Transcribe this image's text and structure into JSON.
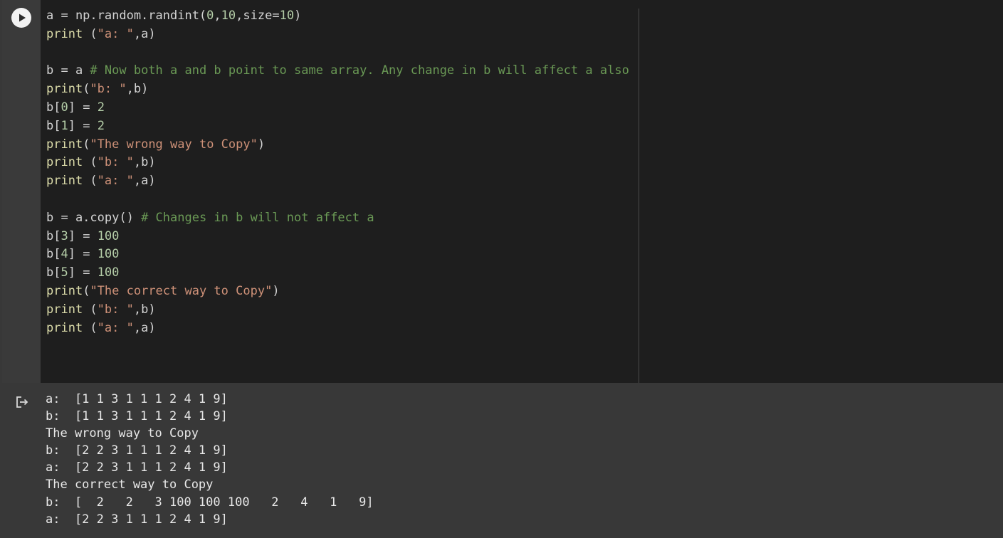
{
  "code_cell": {
    "run_button_icon": "play-icon",
    "lines": [
      [
        [
          "default",
          "a = np.random.randint("
        ],
        [
          "num",
          "0"
        ],
        [
          "default",
          ","
        ],
        [
          "num",
          "10"
        ],
        [
          "default",
          ",size="
        ],
        [
          "num",
          "10"
        ],
        [
          "default",
          ")"
        ]
      ],
      [
        [
          "fn",
          "print"
        ],
        [
          "default",
          " ("
        ],
        [
          "str",
          "\"a: \""
        ],
        [
          "default",
          ",a)"
        ]
      ],
      [],
      [
        [
          "default",
          "b = a "
        ],
        [
          "cmt",
          "# Now both a and b point to same array. Any change in b will affect a also"
        ]
      ],
      [
        [
          "fn",
          "print"
        ],
        [
          "default",
          "("
        ],
        [
          "str",
          "\"b: \""
        ],
        [
          "default",
          ",b)"
        ]
      ],
      [
        [
          "default",
          "b["
        ],
        [
          "num",
          "0"
        ],
        [
          "default",
          "] = "
        ],
        [
          "num",
          "2"
        ]
      ],
      [
        [
          "default",
          "b["
        ],
        [
          "num",
          "1"
        ],
        [
          "default",
          "] = "
        ],
        [
          "num",
          "2"
        ]
      ],
      [
        [
          "fn",
          "print"
        ],
        [
          "default",
          "("
        ],
        [
          "str",
          "\"The wrong way to Copy\""
        ],
        [
          "default",
          ")"
        ]
      ],
      [
        [
          "fn",
          "print"
        ],
        [
          "default",
          " ("
        ],
        [
          "str",
          "\"b: \""
        ],
        [
          "default",
          ",b)"
        ]
      ],
      [
        [
          "fn",
          "print"
        ],
        [
          "default",
          " ("
        ],
        [
          "str",
          "\"a: \""
        ],
        [
          "default",
          ",a)"
        ]
      ],
      [],
      [
        [
          "default",
          "b = a.copy() "
        ],
        [
          "cmt",
          "# Changes in b will not affect a"
        ]
      ],
      [
        [
          "default",
          "b["
        ],
        [
          "num",
          "3"
        ],
        [
          "default",
          "] = "
        ],
        [
          "num",
          "100"
        ]
      ],
      [
        [
          "default",
          "b["
        ],
        [
          "num",
          "4"
        ],
        [
          "default",
          "] = "
        ],
        [
          "num",
          "100"
        ]
      ],
      [
        [
          "default",
          "b["
        ],
        [
          "num",
          "5"
        ],
        [
          "default",
          "] = "
        ],
        [
          "num",
          "100"
        ]
      ],
      [
        [
          "fn",
          "print"
        ],
        [
          "default",
          "("
        ],
        [
          "str",
          "\"The correct way to Copy\""
        ],
        [
          "default",
          ")"
        ]
      ],
      [
        [
          "fn",
          "print"
        ],
        [
          "default",
          " ("
        ],
        [
          "str",
          "\"b: \""
        ],
        [
          "default",
          ",b)"
        ]
      ],
      [
        [
          "fn",
          "print"
        ],
        [
          "default",
          " ("
        ],
        [
          "str",
          "\"a: \""
        ],
        [
          "default",
          ",a)"
        ]
      ]
    ]
  },
  "output_cell": {
    "icon": "output-arrow-icon",
    "lines": [
      "a:  [1 1 3 1 1 1 2 4 1 9]",
      "b:  [1 1 3 1 1 1 2 4 1 9]",
      "The wrong way to Copy",
      "b:  [2 2 3 1 1 1 2 4 1 9]",
      "a:  [2 2 3 1 1 1 2 4 1 9]",
      "The correct way to Copy",
      "b:  [  2   2   3 100 100 100   2   4   1   9]",
      "a:  [2 2 3 1 1 1 2 4 1 9]"
    ]
  },
  "colors": {
    "editor_bg": "#1e1e1e",
    "output_bg": "#383838",
    "string": "#ce9178",
    "number": "#b5cea8",
    "comment": "#6a9955",
    "function": "#dcdcaa",
    "text": "#d4d4d4"
  }
}
